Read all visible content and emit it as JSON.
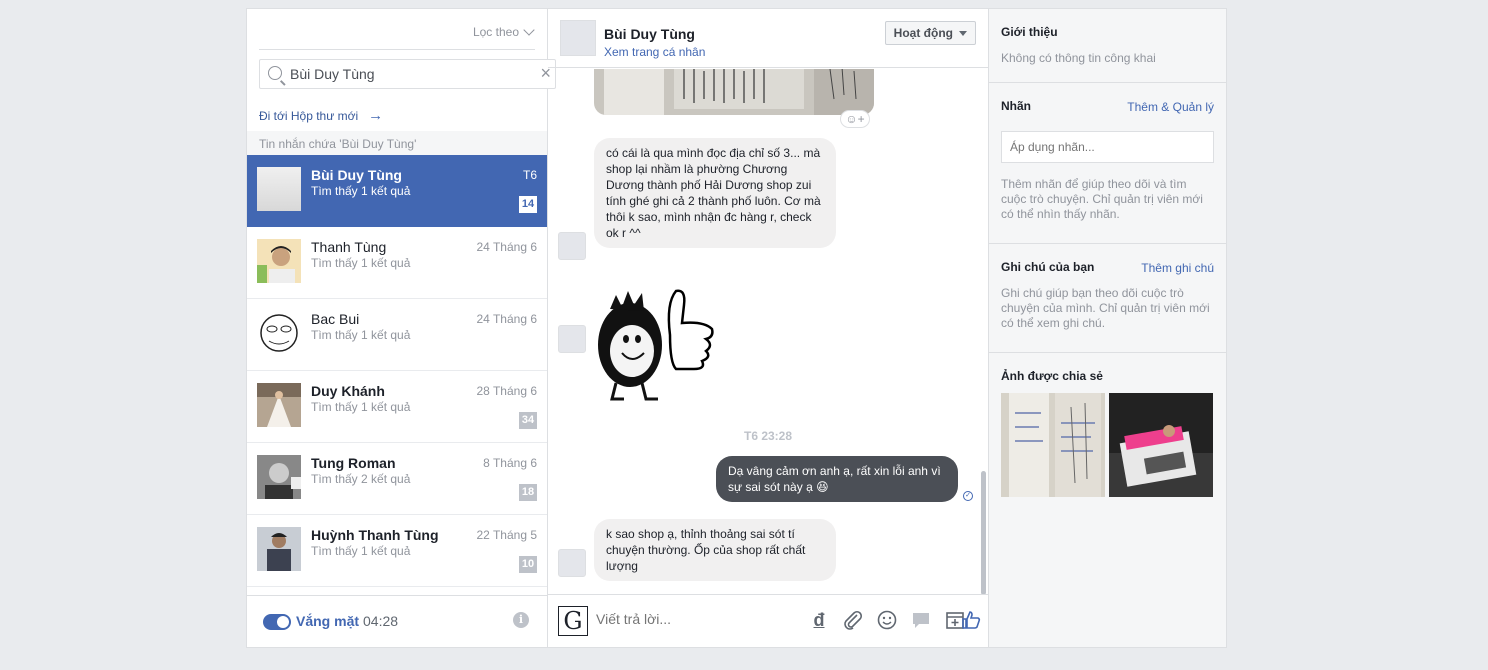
{
  "left": {
    "filter_label": "Lọc theo",
    "search_value": "Bùi Duy Tùng",
    "clear": "×",
    "goto_inbox": "Đi tới Hộp thư mới",
    "goto_arrow": "→",
    "section_header": "Tin nhắn chứa 'Bùi Duy Tùng'",
    "conversations": [
      {
        "name": "Bùi Duy Tùng",
        "sub": "Tìm thấy 1 kết quả",
        "date": "T6",
        "count": "14"
      },
      {
        "name": "Thanh Tùng",
        "sub": "Tìm thấy 1 kết quả",
        "date": "24 Tháng 6",
        "count": ""
      },
      {
        "name": "Bac Bui",
        "sub": "Tìm thấy 1 kết quả",
        "date": "24 Tháng 6",
        "count": ""
      },
      {
        "name": "Duy Khánh",
        "sub": "Tìm thấy 1 kết quả",
        "date": "28 Tháng 6",
        "count": "34"
      },
      {
        "name": "Tung Roman",
        "sub": "Tìm thấy 2 kết quả",
        "date": "8 Tháng 6",
        "count": "18"
      },
      {
        "name": "Huỳnh Thanh Tùng",
        "sub": "Tìm thấy 1 kết quả",
        "date": "22 Tháng 5",
        "count": "10"
      }
    ],
    "away_label": "Vắng mặt",
    "away_time": "04:28",
    "info": "i"
  },
  "center": {
    "name": "Bùi Duy Tùng",
    "profile_link": "Xem trang cá nhân",
    "status": "Hoạt động",
    "react": "☺+",
    "messages": {
      "m1": "có cái là qua mình đọc địa chỉ số 3... mà shop lại nhầm là phường Chương Dương thành phố Hải Dương shop zui tính ghé ghi cả 2 thành phố luôn. Cơ mà thôi k sao, mình nhận đc hàng r, check ok r ^^",
      "timestamp": "T6 23:28",
      "m2": "Dạ vâng cảm ơn anh ạ, rất xin lỗi anh vì sự sai sót này ạ 😆",
      "m3": "k sao shop ạ, thỉnh thoảng sai sót tí chuyện thường. Ốp của shop rất chất lượng"
    },
    "logo": "G",
    "reply_placeholder": "Viết trả lời...",
    "tools": [
      "đ",
      "📎",
      "☺",
      "💬",
      "⊞",
      "👍"
    ]
  },
  "right": {
    "intro_title": "Giới thiệu",
    "intro_text": "Không có thông tin công khai",
    "labels_title": "Nhãn",
    "labels_link": "Thêm & Quản lý",
    "labels_placeholder": "Áp dụng nhãn...",
    "labels_text": "Thêm nhãn để giúp theo dõi và tìm cuộc trò chuyện. Chỉ quản trị viên mới có thể nhìn thấy nhãn.",
    "notes_title": "Ghi chú của bạn",
    "notes_link": "Thêm ghi chú",
    "notes_text": "Ghi chú giúp bạn theo dõi cuộc trò chuyện của mình. Chỉ quản trị viên mới có thể xem ghi chú.",
    "shared_title": "Ảnh được chia sẻ"
  },
  "colors": {
    "accent": "#4267b2",
    "bubble_mine": "#4b4f56",
    "bubble_theirs": "#f1f0f0"
  }
}
